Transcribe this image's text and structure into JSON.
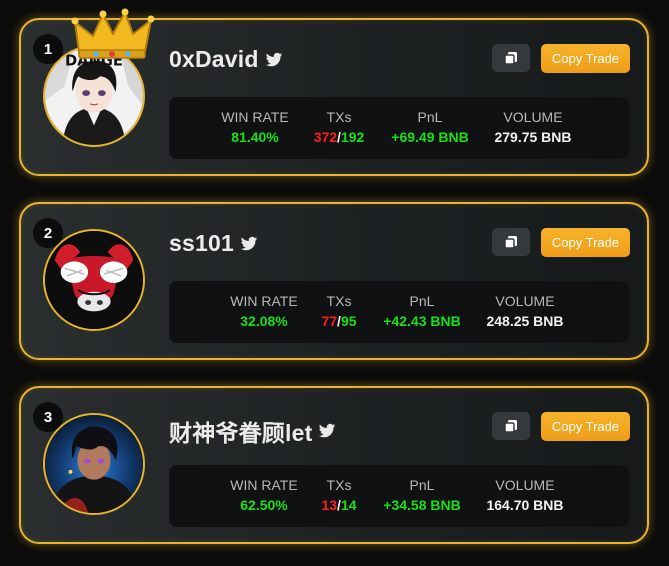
{
  "labels": {
    "win_rate": "WIN RATE",
    "txs": "TXs",
    "pnl": "PnL",
    "volume": "VOLUME",
    "copy_trade": "Copy Trade",
    "tx_separator": "/"
  },
  "colors": {
    "accent": "#e8b52a",
    "button": "#f7b32b",
    "positive": "#19e019",
    "negative": "#ff1e1e"
  },
  "traders": [
    {
      "rank": "1",
      "name": "0xDavid",
      "win_rate": "81.40%",
      "tx_red": "372",
      "tx_green": "192",
      "pnl": "+69.49 BNB",
      "volume": "279.75 BNB",
      "avatar_text": "DANGE",
      "icons": [
        "crown-icon",
        "twitter-icon",
        "copy-icon"
      ]
    },
    {
      "rank": "2",
      "name": "ss101",
      "win_rate": "32.08%",
      "tx_red": "77",
      "tx_green": "95",
      "pnl": "+42.43 BNB",
      "volume": "248.25 BNB",
      "icons": [
        "twitter-icon",
        "copy-icon"
      ]
    },
    {
      "rank": "3",
      "name": "财神爷眷顾let",
      "win_rate": "62.50%",
      "tx_red": "13",
      "tx_green": "14",
      "pnl": "+34.58 BNB",
      "volume": "164.70 BNB",
      "icons": [
        "twitter-icon",
        "copy-icon"
      ]
    }
  ]
}
